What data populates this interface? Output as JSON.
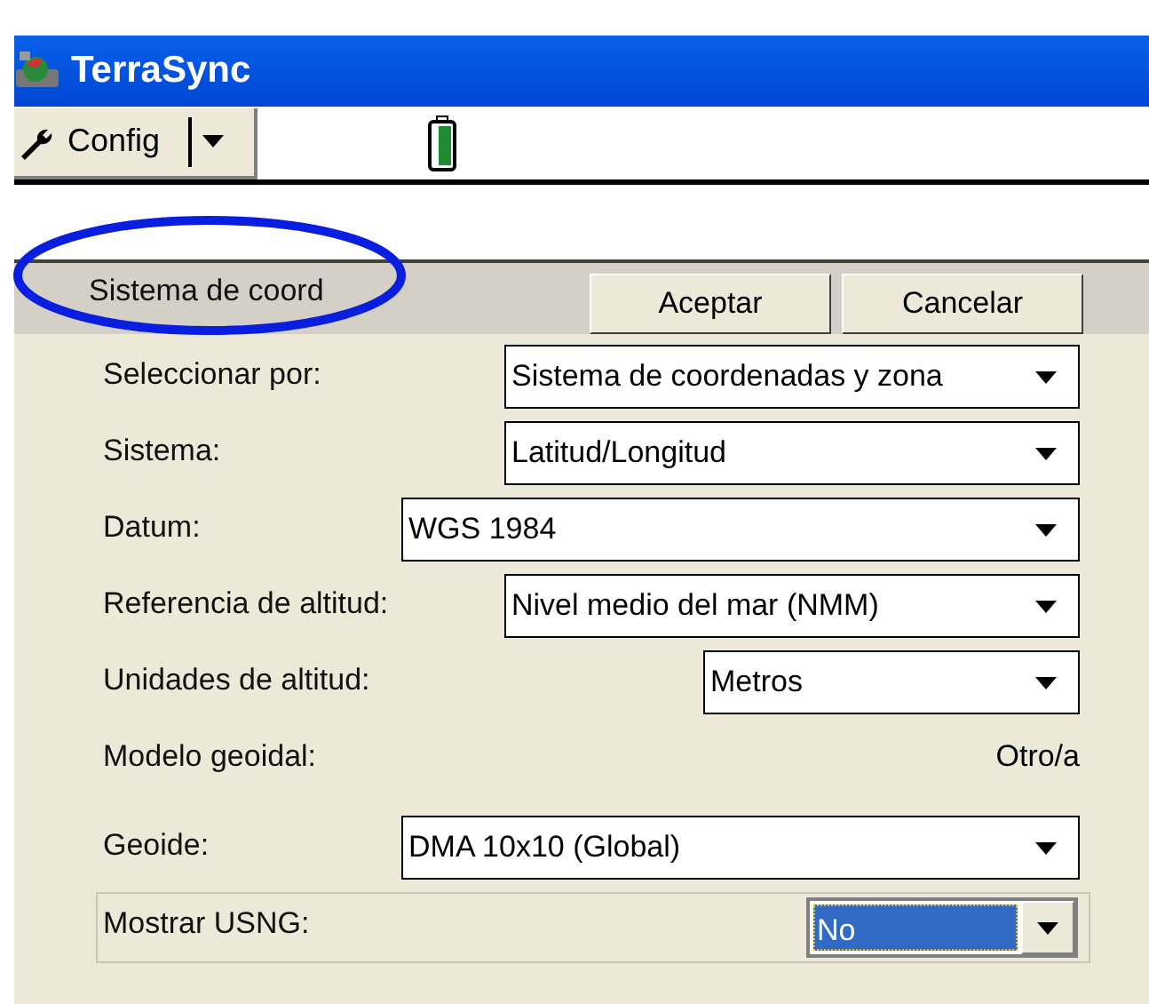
{
  "window": {
    "title": "TerraSync"
  },
  "toolbar": {
    "menu_button": "Config"
  },
  "panel": {
    "title": "Sistema de coord",
    "buttons": [
      "Aceptar",
      "Cancelar"
    ]
  },
  "fields": [
    {
      "label": "Seleccionar por:",
      "kind": "dropdown",
      "value": "Sistema de coordenadas y zona"
    },
    {
      "label": "Sistema:",
      "kind": "dropdown",
      "value": "Latitud/Longitud"
    },
    {
      "label": "Datum:",
      "kind": "dropdown",
      "value": "WGS 1984"
    },
    {
      "label": "Referencia de altitud:",
      "kind": "dropdown",
      "value": "Nivel medio del mar (NMM)"
    },
    {
      "label": "Unidades de altitud:",
      "kind": "dropdown",
      "value": "Metros"
    },
    {
      "label": "Modelo geoidal:",
      "kind": "readout",
      "value": "Otro/a"
    },
    {
      "label": "Geoide:",
      "kind": "dropdown",
      "value": "DMA 10x10 (Global)"
    },
    {
      "label": "Mostrar USNG:",
      "kind": "combo",
      "value": "No",
      "focused": true
    }
  ]
}
